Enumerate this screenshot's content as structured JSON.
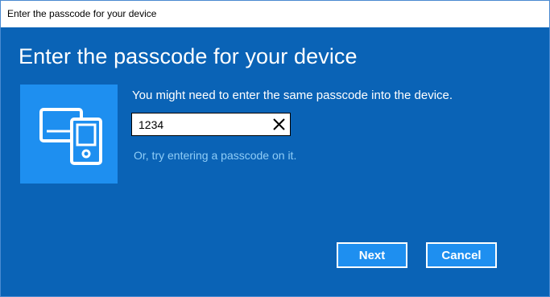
{
  "window": {
    "title": "Enter the passcode for your device"
  },
  "main": {
    "heading": "Enter the passcode for your device",
    "device_icon": "devices-icon",
    "instructions": "You might need to enter the same passcode into the device.",
    "passcode": {
      "value": "1234",
      "clear_icon": "close-icon"
    },
    "alt_link": "Or, try entering a passcode on it."
  },
  "buttons": {
    "next_label": "Next",
    "cancel_label": "Cancel"
  },
  "colors": {
    "background": "#0a63b6",
    "accent": "#1e8ff0",
    "link": "#8fcdf7"
  }
}
